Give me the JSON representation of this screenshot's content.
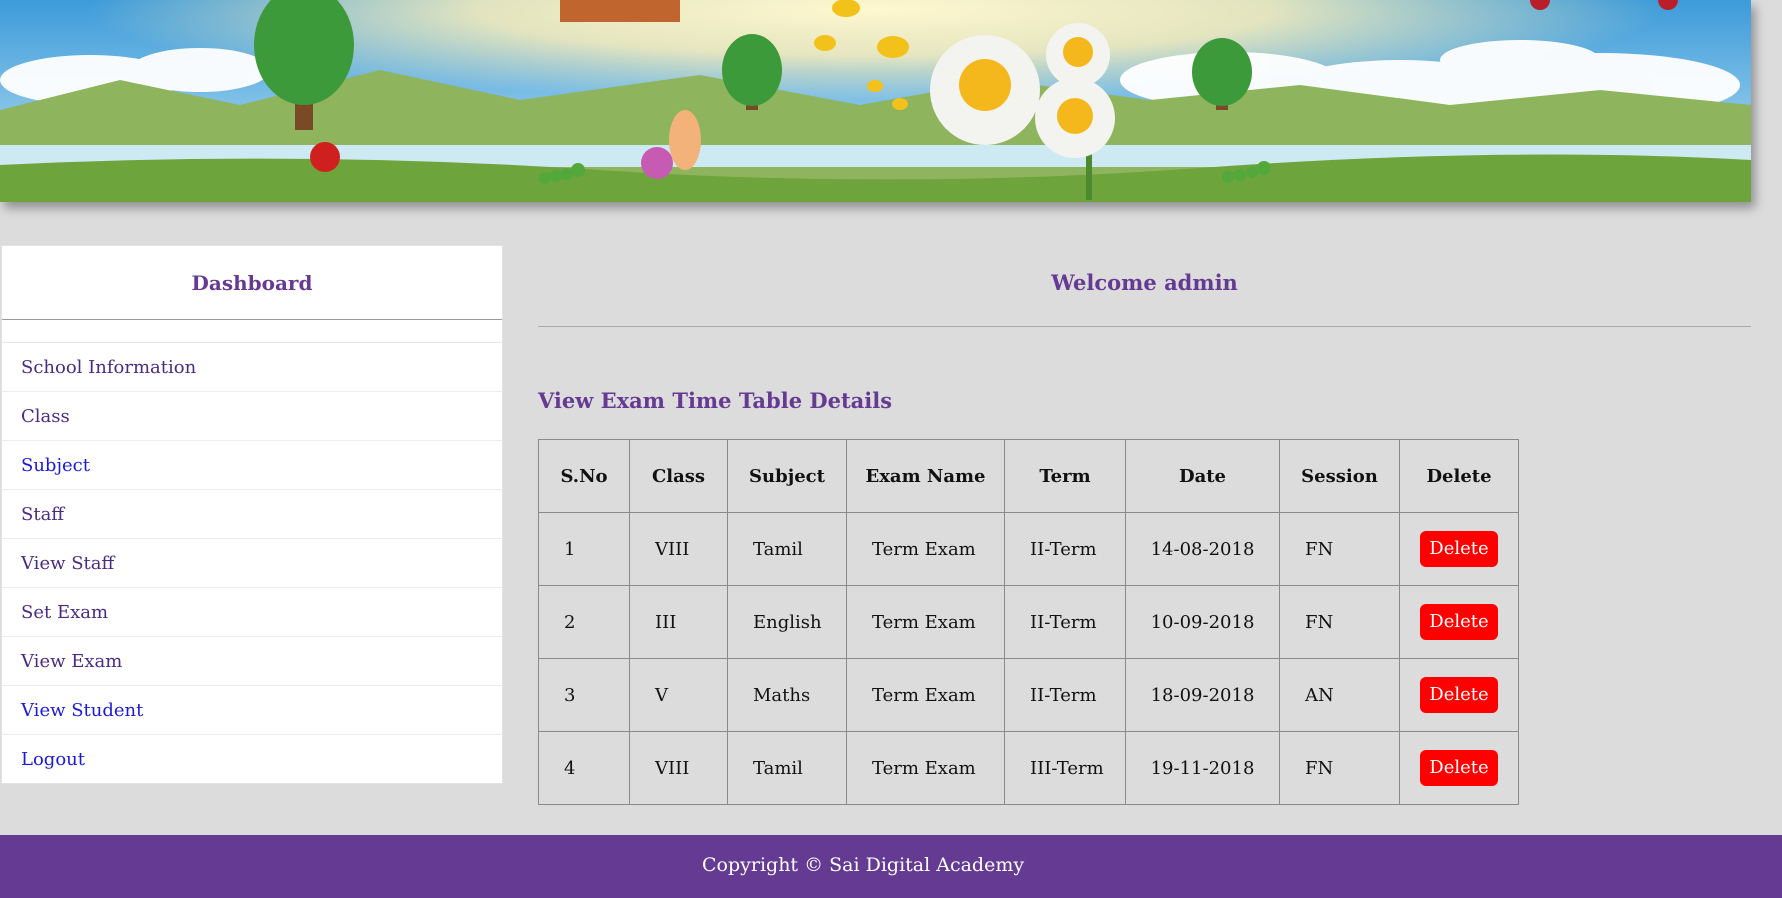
{
  "sidebar": {
    "title": "Dashboard",
    "items": [
      {
        "label": "School Information"
      },
      {
        "label": "Class"
      },
      {
        "label": "Subject"
      },
      {
        "label": "Staff"
      },
      {
        "label": "View Staff"
      },
      {
        "label": "Set Exam"
      },
      {
        "label": "View Exam"
      },
      {
        "label": "View Student"
      },
      {
        "label": "Logout"
      }
    ]
  },
  "main": {
    "welcome": "Welcome admin",
    "section_title": "View Exam Time Table Details",
    "table": {
      "headers": [
        "S.No",
        "Class",
        "Subject",
        "Exam Name",
        "Term",
        "Date",
        "Session",
        "Delete"
      ],
      "rows": [
        {
          "sno": "1",
          "class": "VIII",
          "subject": "Tamil",
          "exam": "Term Exam",
          "term": "II-Term",
          "date": "14-08-2018",
          "session": "FN",
          "action": "Delete"
        },
        {
          "sno": "2",
          "class": "III",
          "subject": "English",
          "exam": "Term Exam",
          "term": "II-Term",
          "date": "10-09-2018",
          "session": "FN",
          "action": "Delete"
        },
        {
          "sno": "3",
          "class": "V",
          "subject": "Maths",
          "exam": "Term Exam",
          "term": "II-Term",
          "date": "18-09-2018",
          "session": "AN",
          "action": "Delete"
        },
        {
          "sno": "4",
          "class": "VIII",
          "subject": "Tamil",
          "exam": "Term Exam",
          "term": "III-Term",
          "date": "19-11-2018",
          "session": "FN",
          "action": "Delete"
        }
      ]
    }
  },
  "footer": {
    "copyright": "Copyright © Sai Digital Academy"
  },
  "colors": {
    "accent": "#663a93",
    "footer_bg": "#643a93",
    "delete_button": "#ff0000",
    "link_blue": "#1a1adb",
    "page_bg": "#dcdcdc"
  }
}
